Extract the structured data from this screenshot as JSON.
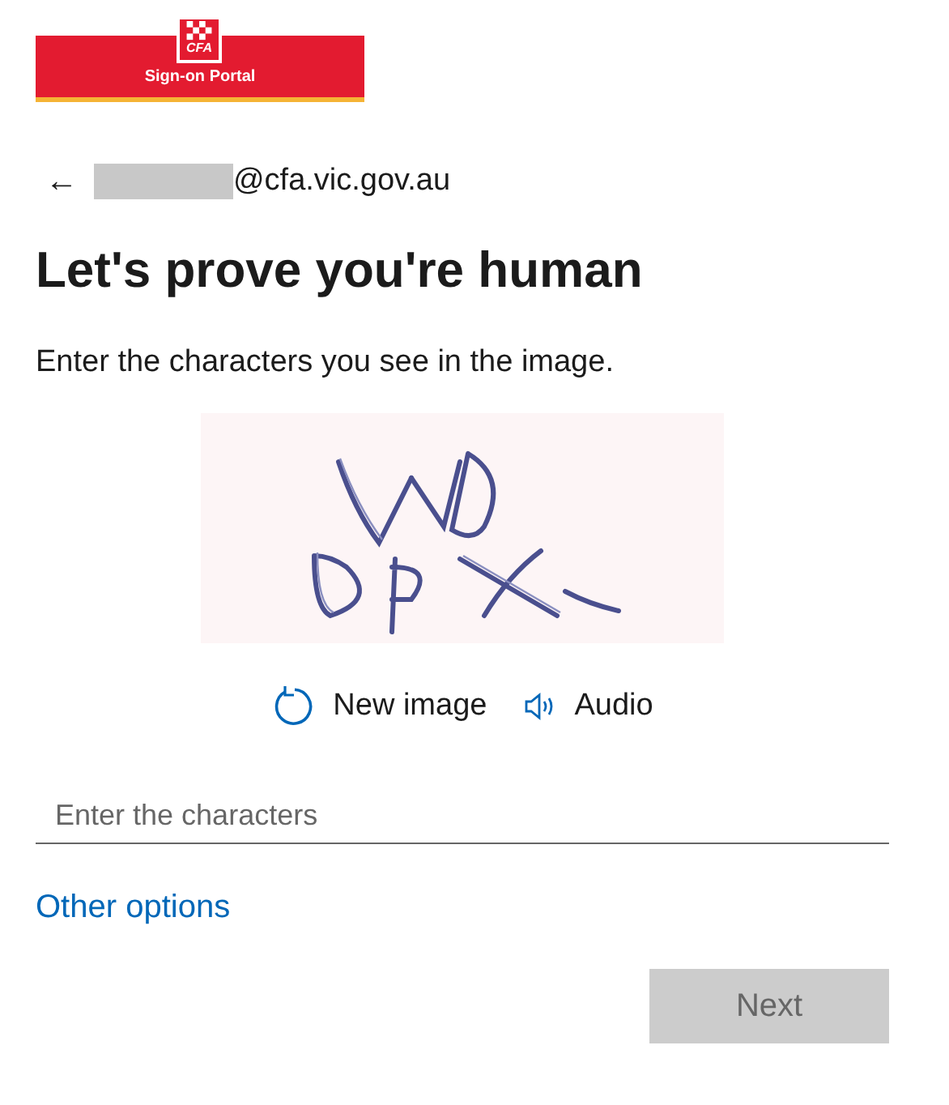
{
  "logo": {
    "emblem_text": "CFA",
    "portal_label": "Sign-on Portal"
  },
  "account": {
    "back_icon": "←",
    "email_suffix": "@cfa.vic.gov.au"
  },
  "title": "Let's prove you're human",
  "instruction": "Enter the characters you see in the image.",
  "captcha_actions": [
    {
      "kind": "refresh",
      "label": "New image"
    },
    {
      "kind": "audio",
      "label": "Audio"
    }
  ],
  "input": {
    "placeholder": "Enter the characters"
  },
  "other_options": "Other options",
  "next_button": {
    "label": "Next",
    "disabled": true
  }
}
